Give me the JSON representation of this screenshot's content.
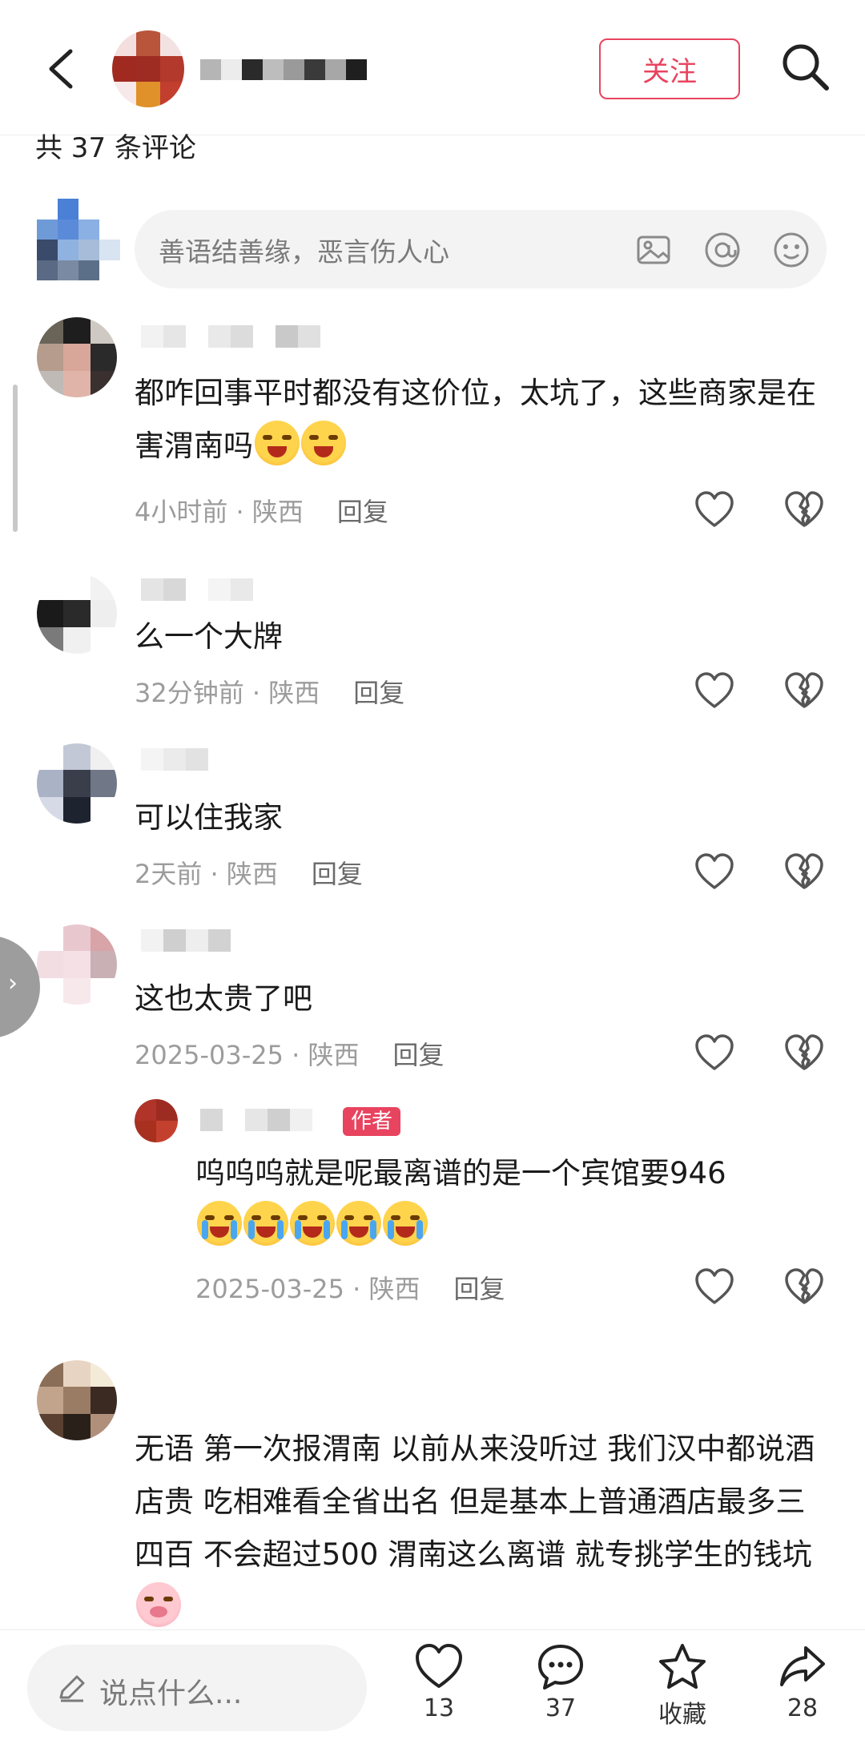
{
  "header": {
    "follow_label": "关注"
  },
  "comments_count_label": "共 37 条评论",
  "compose": {
    "placeholder": "善语结善缘，恶言伤人心"
  },
  "comments": [
    {
      "text": "都咋回事平时都没有这价位，太坑了，这些商家是在害渭南吗",
      "emoji": [
        "laughing-face-emoji",
        "laughing-face-emoji"
      ],
      "time": "4小时前",
      "location": "陕西",
      "reply_label": "回复"
    },
    {
      "text": "么一个大牌",
      "time": "32分钟前",
      "location": "陕西",
      "reply_label": "回复"
    },
    {
      "text": "可以住我家",
      "time": "2天前",
      "location": "陕西",
      "reply_label": "回复"
    },
    {
      "text": "这也太贵了吧",
      "time": "2025-03-25",
      "location": "陕西",
      "reply_label": "回复"
    },
    {
      "is_reply": true,
      "badge": "作者",
      "text": "呜呜呜就是呢最离谱的是一个宾馆要946",
      "emoji": [
        "crying-face-emoji",
        "crying-face-emoji",
        "crying-face-emoji",
        "crying-face-emoji",
        "crying-face-emoji"
      ],
      "time": "2025-03-25",
      "location": "陕西",
      "reply_label": "回复"
    },
    {
      "text": "无语 第一次报渭南 以前从来没听过 我们汉中都说酒店贵 吃相难看全省出名 但是基本上普通酒店最多三四百 不会超过500 渭南这么离谱 就专挑学生的钱坑",
      "emoji": [
        "pig-face-emoji"
      ]
    }
  ],
  "bottom_bar": {
    "say_placeholder": "说点什么...",
    "like_count": "13",
    "comment_count": "37",
    "favorite_label": "收藏",
    "share_count": "28"
  },
  "side_tab_icon": "chevron-right-icon",
  "colors": {
    "accent": "#e8445f",
    "meta_gray": "#9c9c9c",
    "input_bg": "#f3f3f3"
  }
}
